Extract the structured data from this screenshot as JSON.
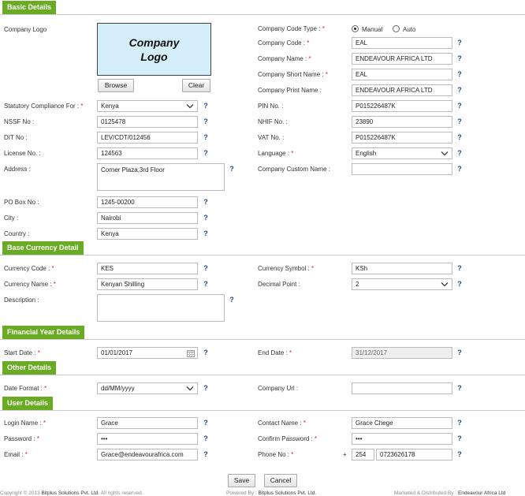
{
  "sections": {
    "basic": "Basic Details",
    "currency": "Base Currency Detail",
    "financial": "Financial Year Details",
    "other": "Other Details",
    "user": "User Details"
  },
  "logo": {
    "label": "Company Logo",
    "line1": "Company",
    "line2": "Logo",
    "browse": "Browse",
    "clear": "Clear"
  },
  "basic": {
    "code_type_label": "Company Code Type :",
    "code_type_manual": "Manual",
    "code_type_auto": "Auto",
    "code_type_selected": "Manual",
    "company_code_label": "Company Code :",
    "company_code": "EAL",
    "company_name_label": "Company Name :",
    "company_name": "ENDEAVOUR AFRICA LTD",
    "short_name_label": "Company Short Name :",
    "short_name": "EAL",
    "print_name_label": "Company Print Name :",
    "print_name": "ENDEAVOUR AFRICA LTD",
    "statutory_label": "Statutory Compliance For :",
    "statutory": "Kenya",
    "pin_label": "PIN No. :",
    "pin": "P015226487K",
    "nssf_label": "NSSF No :",
    "nssf": "0125478",
    "nhif_label": "NHIF No. :",
    "nhif": "23890",
    "dit_label": "DIT No :",
    "dit": "LEV/CDT/012456",
    "vat_label": "VAT No. :",
    "vat": "P015226487K",
    "license_label": "License No. :",
    "license": "124563",
    "language_label": "Language :",
    "language": "English",
    "address_label": "Address :",
    "address": "Corner Plaza,3rd Floor",
    "custom_name_label": "Company Custom Name :",
    "custom_name": "",
    "pobox_label": "PO Box No :",
    "pobox": "1245-00200",
    "city_label": "City :",
    "city": "Nairobi",
    "country_label": "Country :",
    "country": "Kenya"
  },
  "currency": {
    "code_label": "Currency Code :",
    "code": "KES",
    "symbol_label": "Currency Symbol :",
    "symbol": "KSh",
    "name_label": "Currency Name :",
    "name": "Kenyan Shilling",
    "decimal_label": "Decimal Point :",
    "decimal": "2",
    "description_label": "Description :",
    "description": ""
  },
  "financial": {
    "start_label": "Start Date :",
    "start": "01/01/2017",
    "end_label": "End Date :",
    "end": "31/12/2017"
  },
  "other": {
    "date_format_label": "Date Format :",
    "date_format": "dd/MM/yyyy",
    "url_label": "Company Url :",
    "url": ""
  },
  "user": {
    "login_label": "Login Name :",
    "login": "Grace",
    "contact_label": "Contact Name :",
    "contact": "Grace Chege",
    "password_label": "Password :",
    "password": "•••",
    "confirm_label": "Confirm Password :",
    "confirm": "•••",
    "email_label": "Email :",
    "email": "Grace@endeavourafrica.com",
    "phone_label": "Phone No :",
    "phone_plus": "+",
    "phone_code": "254",
    "phone": "0723626178"
  },
  "actions": {
    "save": "Save",
    "cancel": "Cancel"
  },
  "footer": {
    "copyright_pre": "Copyright © 2013",
    "copyright_company": "Bitplus Solutions Pvt. Ltd.",
    "copyright_post": "All rights reserved.",
    "powered_pre": "Powered By :",
    "powered_company": "Bitplus Solutions Pvt. Ltd.",
    "marketed_pre": "Marketed & Distributed By :",
    "marketed_company": "Endeavour Africa Ltd"
  },
  "help_glyph": "?",
  "required_mark": "*",
  "colors": {
    "section_green": "#6aab24",
    "help_blue": "#1a4a8a",
    "logo_bg": "#d3eef8"
  }
}
